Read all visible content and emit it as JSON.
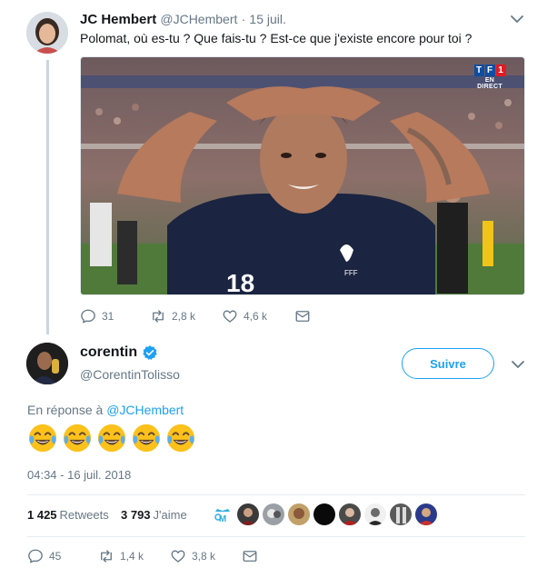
{
  "reply": {
    "name": "JC Hembert",
    "handle": "@JCHembert",
    "dot": "·",
    "date": "15 juil.",
    "text": "Polomat, où es-tu ? Que fais-tu ? Est-ce que j'existe encore pour toi ?",
    "photo_badge": {
      "letters": [
        "T",
        "F",
        "1"
      ],
      "sub": "EN DIRECT"
    },
    "replies": "31",
    "retweets": "2,8 k",
    "likes": "4,6 k"
  },
  "main": {
    "name": "corentin",
    "handle": "@CorentinTolisso",
    "follow_label": "Suivre",
    "in_reply_prefix": "En réponse à",
    "in_reply_mention": "@JCHembert",
    "emoji_count": 5,
    "timestamp": "04:34 - 16 juil. 2018",
    "retweets_count": "1 425",
    "retweets_label": "Retweets",
    "likes_count": "3 793",
    "likes_label": "J'aime",
    "replies": "45",
    "retweets": "1,4 k",
    "likes": "3,8 k"
  },
  "colors": {
    "accent": "#1da1f2",
    "muted": "#657786",
    "verified": "#1da1f2",
    "thread_line": "#ccd6dd"
  }
}
